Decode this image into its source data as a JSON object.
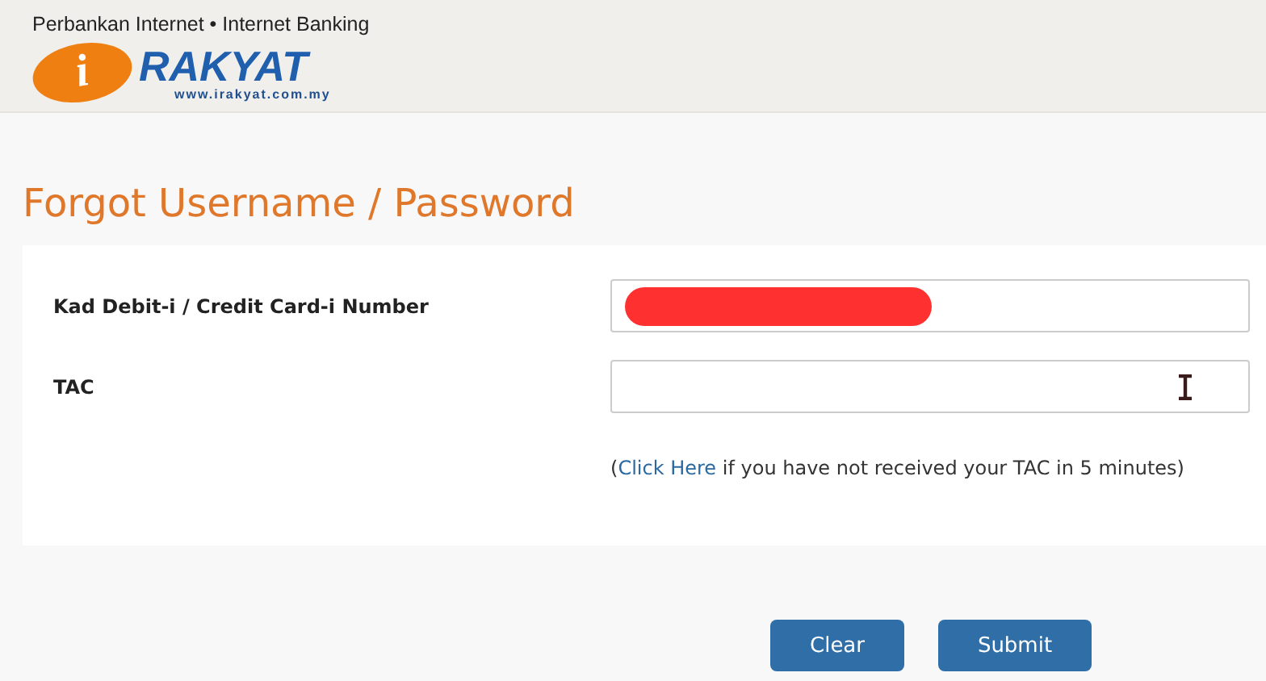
{
  "header": {
    "tagline": "Perbankan Internet • Internet Banking",
    "logo": {
      "letter": "i",
      "name": "RAKYAT",
      "url": "www.irakyat.com.my"
    }
  },
  "title": "Forgot Username / Password",
  "fields": [
    {
      "label": "Kad Debit-i / Credit Card-i Number",
      "redacted": true,
      "cursor": false
    },
    {
      "label": "TAC",
      "redacted": false,
      "cursor": true
    }
  ],
  "help": {
    "open": "(",
    "link": "Click Here",
    "rest": " if you have not received your TAC in 5 minutes)"
  },
  "buttons": [
    "Clear",
    "Submit"
  ]
}
